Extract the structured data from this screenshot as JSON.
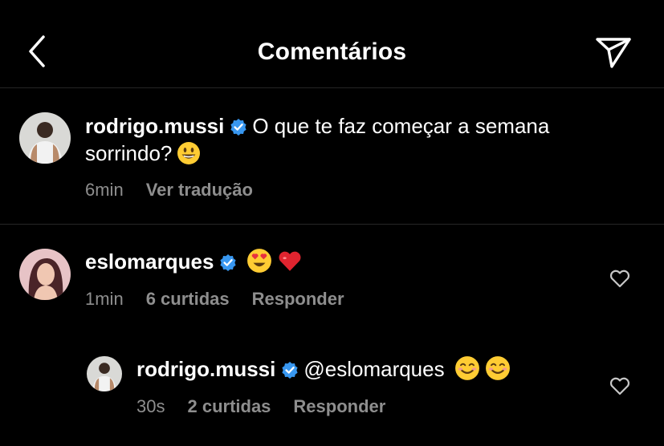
{
  "header": {
    "title": "Comentários",
    "back_icon": "chevron-left-icon",
    "send_icon": "send-icon"
  },
  "caption": {
    "username": "rodrigo.mussi",
    "text_line1": "O que te faz começar a semana",
    "text_line2": "sorrindo?",
    "emoji": "grinning-face",
    "time": "6min",
    "translate_label": "Ver tradução"
  },
  "comments": [
    {
      "username": "eslomarques",
      "text": "",
      "emojis": [
        "heart-eyes",
        "red-heart"
      ],
      "time": "1min",
      "likes": "6 curtidas",
      "reply_label": "Responder"
    },
    {
      "username": "rodrigo.mussi",
      "text": "@eslomarques",
      "emojis": [
        "smiling-face",
        "smiling-face"
      ],
      "time": "30s",
      "likes": "2 curtidas",
      "reply_label": "Responder"
    }
  ],
  "colors": {
    "background": "#000000",
    "text": "#ffffff",
    "meta": "#8e8e8e",
    "verified": "#3897f0",
    "divider": "#262626"
  }
}
